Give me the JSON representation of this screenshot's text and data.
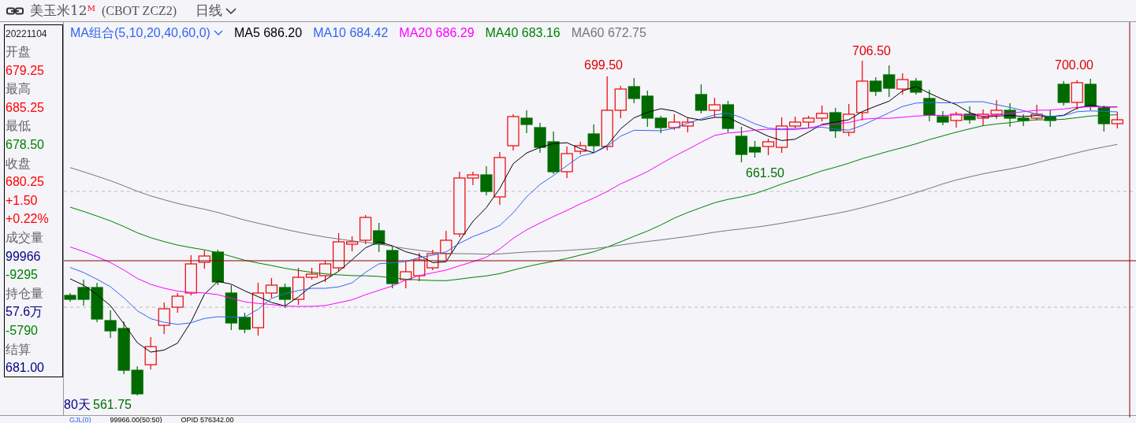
{
  "title_bar": {
    "title": "美玉米12",
    "superscript": "M",
    "code": "(CBOT  ZCZ2)",
    "period": "日线"
  },
  "info_panel": {
    "date": "20221104",
    "lines": [
      {
        "text": "开盘",
        "color": "#666666"
      },
      {
        "text": "679.25",
        "color": "#ff0000"
      },
      {
        "text": "最高",
        "color": "#666666"
      },
      {
        "text": "685.25",
        "color": "#ff0000"
      },
      {
        "text": "最低",
        "color": "#666666"
      },
      {
        "text": "678.50",
        "color": "#008000"
      },
      {
        "text": "收盘",
        "color": "#666666"
      },
      {
        "text": "680.25",
        "color": "#ff0000"
      },
      {
        "text": "+1.50",
        "color": "#ff0000"
      },
      {
        "text": "+0.22%",
        "color": "#ff0000"
      },
      {
        "text": "成交量",
        "color": "#666666"
      },
      {
        "text": "99966",
        "color": "#000080"
      },
      {
        "text": "-9295",
        "color": "#008000"
      },
      {
        "text": "持仓量",
        "color": "#666666"
      },
      {
        "text": "57.6万",
        "color": "#000080"
      },
      {
        "text": "-5790",
        "color": "#008000"
      },
      {
        "text": "结算",
        "color": "#666666"
      },
      {
        "text": "681.00",
        "color": "#000080"
      }
    ]
  },
  "legend": {
    "indicator": "MA组合(5,10,20,40,60,0)",
    "series": [
      {
        "name": "MA5",
        "value": "686.20",
        "color": "#000000"
      },
      {
        "name": "MA10",
        "value": "684.42",
        "color": "#3366ee"
      },
      {
        "name": "MA20",
        "value": "686.29",
        "color": "#ff00ff"
      },
      {
        "name": "MA40",
        "value": "683.16",
        "color": "#008000"
      },
      {
        "name": "MA60",
        "value": "672.75",
        "color": "#777777"
      }
    ]
  },
  "chart": {
    "annotations": [
      {
        "text": "699.50",
        "color": "#e00000"
      },
      {
        "text": "706.50",
        "color": "#e00000"
      },
      {
        "text": "700.00",
        "color": "#e00000"
      },
      {
        "text": "661.50",
        "color": "#007000"
      },
      {
        "text": "561.75",
        "color": "#007000"
      }
    ],
    "span_label": "80天"
  },
  "bottom_strip": [
    "GJL(0)",
    "99966.00(50:50)",
    "OPID 576342.00"
  ]
}
